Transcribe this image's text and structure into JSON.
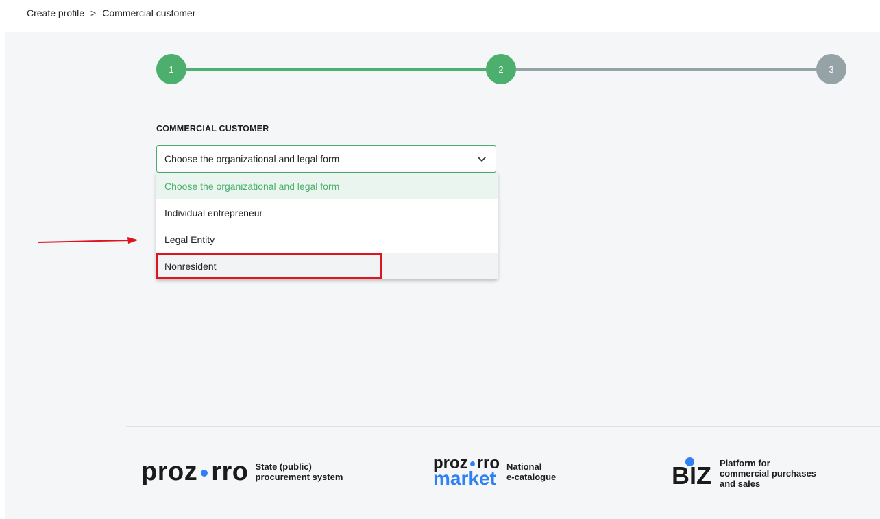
{
  "breadcrumb": {
    "items": [
      "Create profile",
      "Commercial customer"
    ],
    "separator": ">"
  },
  "stepper": {
    "steps": [
      "1",
      "2",
      "3"
    ],
    "current_step": 2
  },
  "form": {
    "section_title": "COMMERCIAL CUSTOMER",
    "select": {
      "selected": "Choose the organizational and legal form",
      "options": [
        "Choose the organizational and legal form",
        "Individual entrepreneur",
        "Legal Entity",
        "Nonresident"
      ]
    }
  },
  "footer": {
    "brands": [
      {
        "logo": "prozorro",
        "description_line1": "State (public)",
        "description_line2": "procurement system"
      },
      {
        "logo_top": "prozorro",
        "logo_bottom": "market",
        "description_line1": "National",
        "description_line2": "e-catalogue"
      },
      {
        "logo": "Biz",
        "description_line1": "Platform for",
        "description_line2": "commercial purchases",
        "description_line3": "and sales"
      }
    ]
  },
  "colors": {
    "accent_green": "#4caf6e",
    "step_inactive": "#95a2a6",
    "brand_blue": "#2f7ff5",
    "annotation_red": "#e0141e"
  }
}
